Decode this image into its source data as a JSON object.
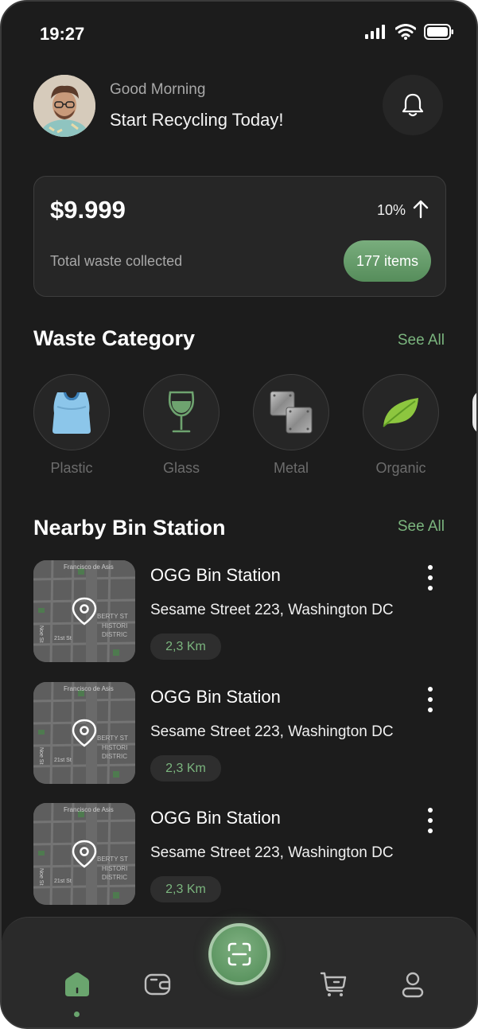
{
  "status_bar": {
    "time": "19:27"
  },
  "header": {
    "greeting": "Good Morning",
    "headline": "Start Recycling Today!"
  },
  "summary_card": {
    "amount": "$9.999",
    "change_percent": "10%",
    "label": "Total waste collected",
    "items_badge": "177 items"
  },
  "waste_category": {
    "title": "Waste Category",
    "see_all": "See All",
    "items": [
      {
        "label": "Plastic",
        "icon": "plastic-bag-icon"
      },
      {
        "label": "Glass",
        "icon": "wine-glass-icon"
      },
      {
        "label": "Metal",
        "icon": "metal-plates-icon"
      },
      {
        "label": "Organic",
        "icon": "leaf-icon"
      }
    ]
  },
  "nearby": {
    "title": "Nearby Bin Station",
    "see_all": "See All",
    "stations": [
      {
        "name": "OGG Bin Station",
        "address": "Sesame Street 223, Washington DC",
        "distance": "2,3 Km",
        "map_labels": [
          "Francisco de Asis",
          "Noe St",
          "21st St",
          "BERTY ST",
          "HISTORI",
          "DISTRIC"
        ]
      },
      {
        "name": "OGG Bin Station",
        "address": "Sesame Street 223, Washington DC",
        "distance": "2,3 Km",
        "map_labels": [
          "Francisco de Asis",
          "Noe St",
          "21st St",
          "BERTY ST",
          "HISTORI",
          "DISTRIC"
        ]
      },
      {
        "name": "OGG Bin Station",
        "address": "Sesame Street 223, Washington DC",
        "distance": "2,3 Km",
        "map_labels": [
          "Francisco de Asis",
          "Noe St",
          "21st St",
          "BERTY ST",
          "HISTORI",
          "DISTRIC"
        ]
      }
    ]
  },
  "tab_bar": {
    "tabs": [
      {
        "icon": "home-icon",
        "active": true
      },
      {
        "icon": "wallet-icon",
        "active": false
      },
      {
        "icon": "scan-icon",
        "active": false
      },
      {
        "icon": "cart-icon",
        "active": false
      },
      {
        "icon": "profile-icon",
        "active": false
      }
    ]
  },
  "colors": {
    "background": "#1c1c1c",
    "card": "#262626",
    "accent": "#7bb57e"
  }
}
